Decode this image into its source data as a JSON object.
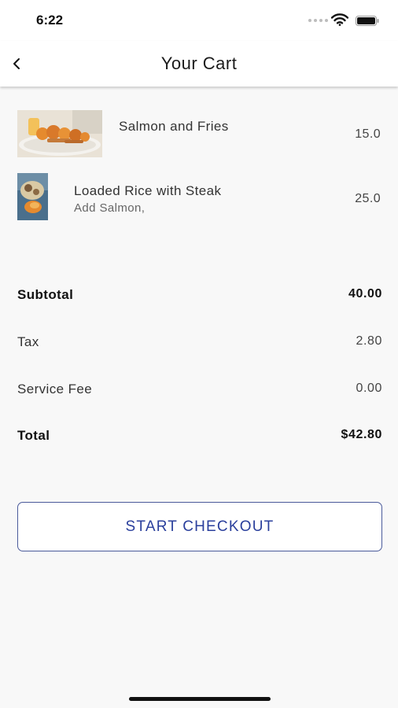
{
  "status_bar": {
    "time": "6:22"
  },
  "header": {
    "title": "Your Cart",
    "back_icon": "chevron-left-icon"
  },
  "cart": {
    "items": [
      {
        "name": "Salmon and Fries",
        "modifier": "",
        "price": "15.0"
      },
      {
        "name": "Loaded Rice with Steak",
        "modifier": "Add Salmon,",
        "price": "25.0"
      }
    ]
  },
  "summary": {
    "subtotal": {
      "label": "Subtotal",
      "value": "40.00"
    },
    "tax": {
      "label": "Tax",
      "value": "2.80"
    },
    "service_fee": {
      "label": "Service Fee",
      "value": "0.00"
    },
    "total": {
      "label": "Total",
      "value": "$42.80"
    }
  },
  "checkout": {
    "button_label": "START CHECKOUT"
  },
  "colors": {
    "accent": "#2a3f9c",
    "background": "#f8f8f8"
  }
}
